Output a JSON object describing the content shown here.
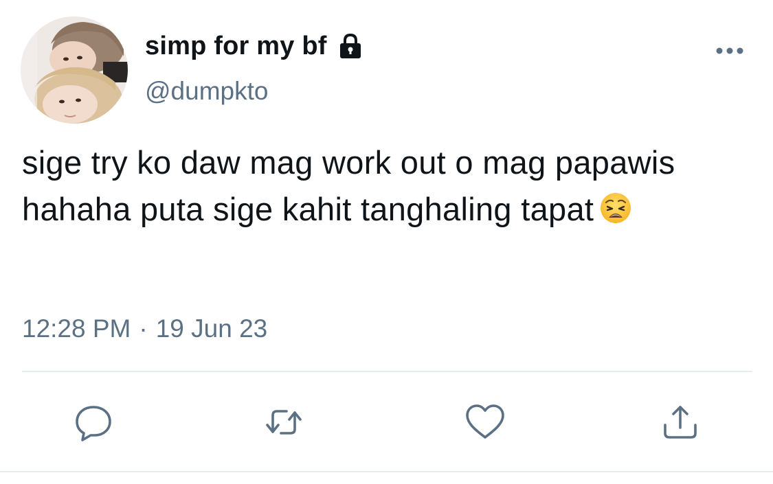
{
  "user": {
    "display_name": "simp for my bf",
    "handle": "@dumpkto",
    "protected": true
  },
  "tweet": {
    "text": "sige try ko daw mag work out o mag papawis hahaha puta sige kahit tanghaling tapat",
    "emoji": "weary-face",
    "time": "12:28 PM",
    "separator": "·",
    "date": "19 Jun 23"
  },
  "icons": {
    "more": "more-horizontal-icon",
    "lock": "lock-icon",
    "reply": "reply-icon",
    "retweet": "retweet-icon",
    "like": "heart-icon",
    "share": "share-icon"
  },
  "colors": {
    "text_primary": "#0f1419",
    "text_secondary": "#5b7083",
    "divider": "#e6ecf0"
  }
}
